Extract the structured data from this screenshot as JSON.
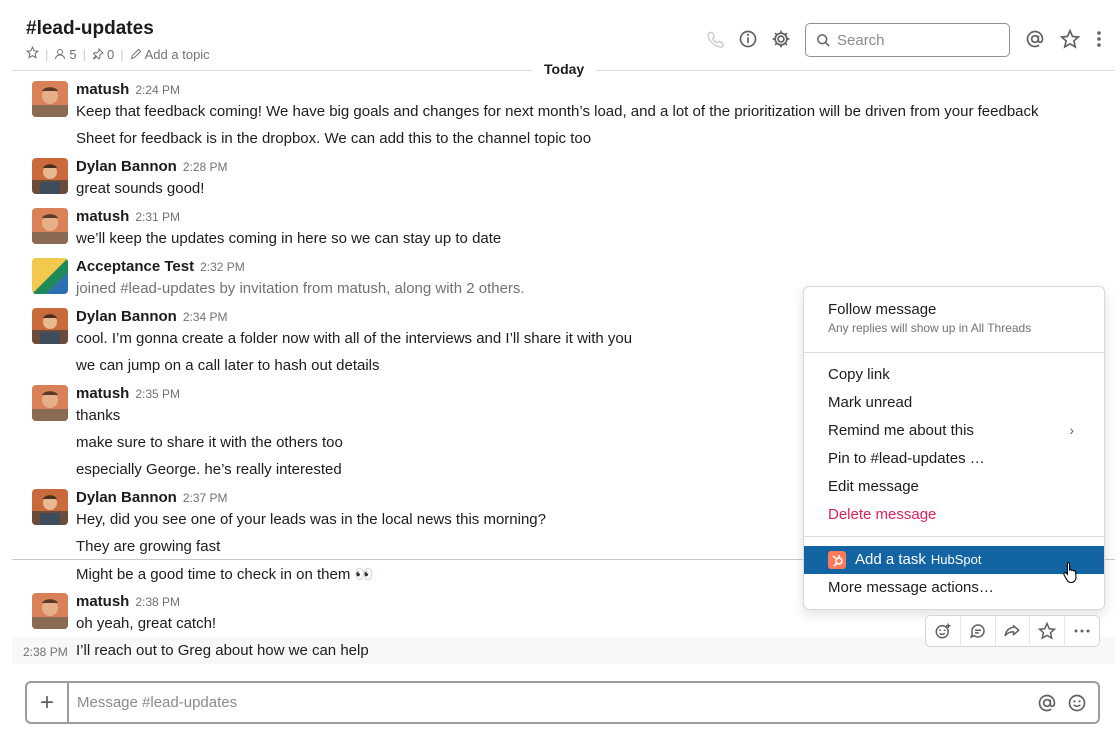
{
  "header": {
    "channel_name": "#lead-updates",
    "members_count": "5",
    "pins_count": "0",
    "add_topic": "Add a topic",
    "search_placeholder": "Search"
  },
  "day_divider": "Today",
  "messages": [
    {
      "sender": "matush",
      "time": "2:24 PM",
      "avatar": "matush",
      "lines": [
        "Keep that feedback coming! We have big goals and changes for next month’s load, and a lot of the prioritization will be driven from your feedback",
        "Sheet for feedback is in the dropbox. We can add this to the channel topic too"
      ]
    },
    {
      "sender": "Dylan Bannon",
      "time": "2:28 PM",
      "avatar": "dylan",
      "lines": [
        "great sounds good!"
      ]
    },
    {
      "sender": "matush",
      "time": "2:31 PM",
      "avatar": "matush",
      "lines": [
        "we’ll keep the updates coming in here so we can stay up to date"
      ]
    },
    {
      "sender": "Acceptance Test",
      "time": "2:32 PM",
      "avatar": "acceptance",
      "lines": [
        "joined #lead-updates by invitation from matush, along with 2 others."
      ]
    },
    {
      "sender": "Dylan Bannon",
      "time": "2:34 PM",
      "avatar": "dylan",
      "lines": [
        "cool. I’m gonna create a folder now with all of the interviews and I’ll share it with you",
        "we can jump on a call later to hash out details"
      ]
    },
    {
      "sender": "matush",
      "time": "2:35 PM",
      "avatar": "matush",
      "lines": [
        "thanks",
        "make sure to share it with the others too",
        "especially George. he’s really interested"
      ]
    },
    {
      "sender": "Dylan Bannon",
      "time": "2:37 PM",
      "avatar": "dylan",
      "lines": [
        "Hey, did you see one of your leads was in the local news this morning?",
        "They are growing fast",
        "Might be a good time to check in on them 👀"
      ]
    },
    {
      "sender": "matush",
      "time": "2:38 PM",
      "avatar": "matush",
      "lines": [
        "oh yeah, great catch!"
      ]
    }
  ],
  "hovered_message": {
    "time": "2:38 PM",
    "text": "I’ll reach out to Greg about how we can help"
  },
  "context_menu": {
    "follow": "Follow message",
    "follow_sub": "Any replies will show up in All Threads",
    "copy_link": "Copy link",
    "mark_unread": "Mark unread",
    "remind": "Remind me about this",
    "pin": "Pin to #lead-updates …",
    "edit": "Edit message",
    "delete": "Delete message",
    "add_task": "Add a task",
    "add_task_brand": "HubSpot",
    "more": "More message actions…"
  },
  "composer": {
    "placeholder": "Message #lead-updates",
    "plus": "+"
  },
  "colors": {
    "accent": "#1264a3",
    "danger": "#e01e5a",
    "hubspot": "#ff7a59"
  }
}
